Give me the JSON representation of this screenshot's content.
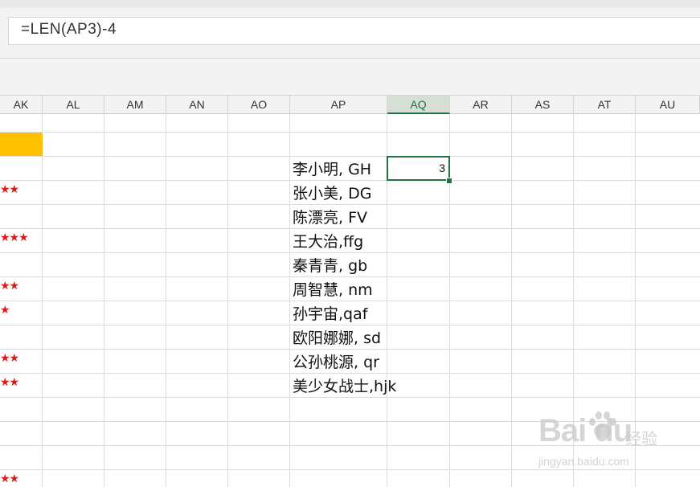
{
  "formula_bar": {
    "formula": "=LEN(AP3)-4"
  },
  "columns": [
    {
      "label": "AK",
      "selected": false
    },
    {
      "label": "AL",
      "selected": false
    },
    {
      "label": "AM",
      "selected": false
    },
    {
      "label": "AN",
      "selected": false
    },
    {
      "label": "AO",
      "selected": false
    },
    {
      "label": "AP",
      "selected": false
    },
    {
      "label": "AQ",
      "selected": true
    },
    {
      "label": "AR",
      "selected": false
    },
    {
      "label": "AS",
      "selected": false
    },
    {
      "label": "AT",
      "selected": false
    },
    {
      "label": "AU",
      "selected": false
    }
  ],
  "names": [
    "李小明, GH",
    "张小美, DG",
    "陈漂亮, FV",
    "王大治,ffg",
    "秦青青, gb",
    "周智慧, nm",
    "孙宇宙,qaf",
    "欧阳娜娜, sd",
    "公孙桃源, qr",
    "美少女战士,hjk"
  ],
  "star_cells": [
    {
      "row": 2,
      "stars": "★★"
    },
    {
      "row": 4,
      "stars": "★★★"
    },
    {
      "row": 6,
      "stars": "★★"
    },
    {
      "row": 7,
      "stars": "★"
    },
    {
      "row": 9,
      "stars": "★★"
    },
    {
      "row": 10,
      "stars": "★★"
    },
    {
      "row": 14,
      "stars": "★★"
    }
  ],
  "active_cell": {
    "column": "AQ",
    "value": "3"
  },
  "colors": {
    "accent": "#217346",
    "highlight": "#ffc000",
    "star": "#e01818"
  },
  "watermark": {
    "brand": "Bai du",
    "label": "经验",
    "url": "jingyan.baidu.com"
  }
}
